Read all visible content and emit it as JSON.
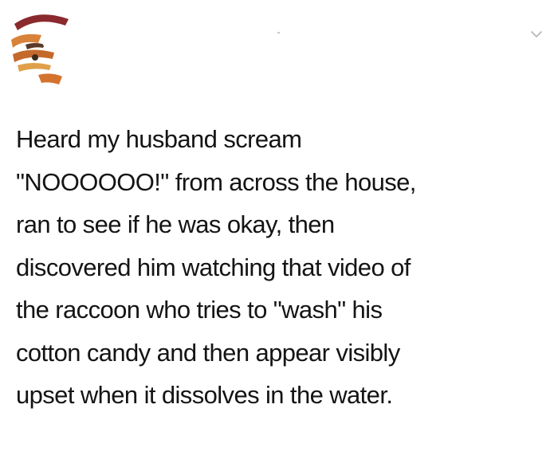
{
  "post": {
    "avatar_icon": "user-avatar-icon",
    "menu_icon": "chevron-down-icon",
    "lines": [
      "Heard my husband scream",
      "\"NOOOOOO!\" from across the house,",
      "ran to see if he was okay, then",
      "discovered him watching that video of",
      "the raccoon who tries to \"wash\" his",
      "cotton candy and then appear visibly",
      "upset when it dissolves in the water."
    ]
  },
  "colors": {
    "background": "#ffffff",
    "text": "#141414",
    "chevron": "#b5b5b5"
  }
}
